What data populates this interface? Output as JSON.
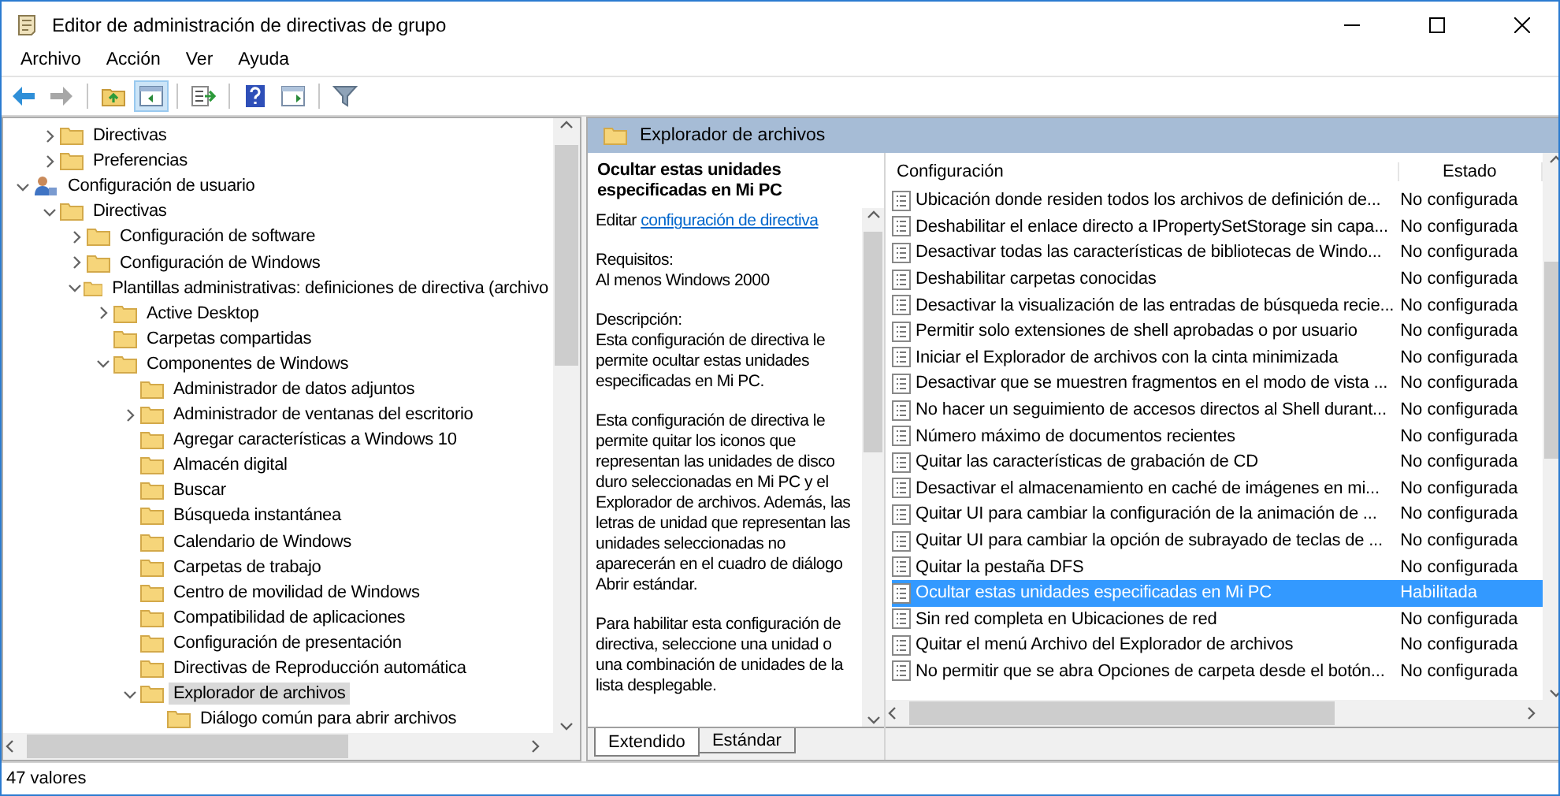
{
  "window": {
    "title": "Editor de administración de directivas de grupo"
  },
  "menu": [
    "Archivo",
    "Acción",
    "Ver",
    "Ayuda"
  ],
  "toolbar": [
    {
      "kind": "back",
      "disabled": false,
      "pressed": false
    },
    {
      "kind": "forward",
      "disabled": true,
      "pressed": false
    },
    {
      "kind": "up",
      "disabled": false,
      "pressed": false
    },
    {
      "kind": "tree",
      "disabled": false,
      "pressed": true
    },
    {
      "kind": "export",
      "disabled": false,
      "pressed": false
    },
    {
      "kind": "help",
      "disabled": false,
      "pressed": false
    },
    {
      "kind": "properties",
      "disabled": false,
      "pressed": false
    },
    {
      "kind": "filter",
      "disabled": false,
      "pressed": false
    }
  ],
  "tree": {
    "partial_branch": [
      {
        "label": "Directivas",
        "kind": "folder",
        "expanded": false,
        "selected": false
      },
      {
        "label": "Preferencias",
        "kind": "folder",
        "expanded": false,
        "selected": false
      }
    ],
    "items": [
      {
        "label": "Configuración de usuario",
        "kind": "user",
        "expanded": true,
        "selected": false,
        "children": [
          {
            "label": "Directivas",
            "kind": "folder",
            "expanded": true,
            "selected": false,
            "children": [
              {
                "label": "Configuración de software",
                "kind": "folder",
                "expanded": false,
                "selected": false
              },
              {
                "label": "Configuración de Windows",
                "kind": "folder",
                "expanded": false,
                "selected": false
              },
              {
                "label": "Plantillas administrativas: definiciones de directiva (archivo",
                "kind": "folder",
                "expanded": true,
                "selected": false,
                "children": [
                  {
                    "label": "Active Desktop",
                    "kind": "folder",
                    "expanded": false,
                    "selected": false
                  },
                  {
                    "label": "Carpetas compartidas",
                    "kind": "folder",
                    "selected": false
                  },
                  {
                    "label": "Componentes de Windows",
                    "kind": "folder",
                    "expanded": true,
                    "selected": false,
                    "children": [
                      {
                        "label": "Administrador de datos adjuntos",
                        "kind": "folder",
                        "selected": false
                      },
                      {
                        "label": "Administrador de ventanas del escritorio",
                        "kind": "folder",
                        "expanded": false,
                        "selected": false
                      },
                      {
                        "label": "Agregar características a Windows 10",
                        "kind": "folder",
                        "selected": false
                      },
                      {
                        "label": "Almacén digital",
                        "kind": "folder",
                        "selected": false
                      },
                      {
                        "label": "Buscar",
                        "kind": "folder",
                        "selected": false
                      },
                      {
                        "label": "Búsqueda instantánea",
                        "kind": "folder",
                        "selected": false
                      },
                      {
                        "label": "Calendario de Windows",
                        "kind": "folder",
                        "selected": false
                      },
                      {
                        "label": "Carpetas de trabajo",
                        "kind": "folder",
                        "selected": false
                      },
                      {
                        "label": "Centro de movilidad de Windows",
                        "kind": "folder",
                        "selected": false
                      },
                      {
                        "label": "Compatibilidad de aplicaciones",
                        "kind": "folder",
                        "selected": false
                      },
                      {
                        "label": "Configuración de presentación",
                        "kind": "folder",
                        "selected": false
                      },
                      {
                        "label": "Directivas de Reproducción automática",
                        "kind": "folder",
                        "selected": false
                      },
                      {
                        "label": "Explorador de archivos",
                        "kind": "folder",
                        "expanded": true,
                        "selected": true,
                        "children": [
                          {
                            "label": "Diálogo común para abrir archivos",
                            "kind": "folder",
                            "selected": false
                          }
                        ]
                      }
                    ]
                  }
                ]
              }
            ]
          }
        ]
      }
    ]
  },
  "pane_header": {
    "title": "Explorador de archivos"
  },
  "description": {
    "title": "Ocultar estas unidades especificadas en Mi PC",
    "edit_prefix": "Editar",
    "edit_link": "configuración de directiva",
    "paragraphs": [
      "Requisitos:\nAl menos Windows 2000",
      "Descripción:\nEsta configuración de directiva le permite ocultar estas unidades especificadas en Mi PC.",
      "Esta configuración de directiva le permite quitar los iconos que representan las unidades de disco duro seleccionadas en Mi PC y el Explorador de archivos. Además, las letras de unidad que representan las unidades seleccionadas no aparecerán en el cuadro de diálogo Abrir estándar.",
      "Para habilitar esta configuración de directiva, seleccione una unidad o una combinación de unidades de la lista desplegable."
    ]
  },
  "view_tabs": [
    {
      "label": "Extendido",
      "selected": true
    },
    {
      "label": "Estándar",
      "selected": false
    }
  ],
  "table": {
    "columns": [
      "Configuración",
      "Estado"
    ],
    "rows": [
      {
        "name": "Ubicación donde residen todos los archivos de definición de...",
        "state": "No configurada",
        "selected": false
      },
      {
        "name": "Deshabilitar el enlace directo a IPropertySetStorage sin capa...",
        "state": "No configurada",
        "selected": false
      },
      {
        "name": "Desactivar todas las características de bibliotecas de Windo...",
        "state": "No configurada",
        "selected": false
      },
      {
        "name": "Deshabilitar carpetas conocidas",
        "state": "No configurada",
        "selected": false
      },
      {
        "name": "Desactivar la visualización de las entradas de búsqueda recie...",
        "state": "No configurada",
        "selected": false
      },
      {
        "name": "Permitir solo extensiones de shell aprobadas o por usuario",
        "state": "No configurada",
        "selected": false
      },
      {
        "name": "Iniciar el Explorador de archivos con la cinta minimizada",
        "state": "No configurada",
        "selected": false
      },
      {
        "name": "Desactivar que se muestren fragmentos en el modo de vista ...",
        "state": "No configurada",
        "selected": false
      },
      {
        "name": "No hacer un seguimiento de accesos directos al Shell durant...",
        "state": "No configurada",
        "selected": false
      },
      {
        "name": "Número máximo de documentos recientes",
        "state": "No configurada",
        "selected": false
      },
      {
        "name": "Quitar las características de grabación de CD",
        "state": "No configurada",
        "selected": false
      },
      {
        "name": "Desactivar el almacenamiento en caché de imágenes en mi...",
        "state": "No configurada",
        "selected": false
      },
      {
        "name": "Quitar UI para cambiar la configuración de la animación de ...",
        "state": "No configurada",
        "selected": false
      },
      {
        "name": "Quitar UI para cambiar la opción de subrayado de teclas de ...",
        "state": "No configurada",
        "selected": false
      },
      {
        "name": "Quitar la pestaña DFS",
        "state": "No configurada",
        "selected": false
      },
      {
        "name": "Ocultar estas unidades especificadas en Mi PC",
        "state": "Habilitada",
        "selected": true
      },
      {
        "name": "Sin red completa en Ubicaciones de red",
        "state": "No configurada",
        "selected": false
      },
      {
        "name": "Quitar el menú Archivo del Explorador de archivos",
        "state": "No configurada",
        "selected": false
      },
      {
        "name": "No permitir que se abra Opciones de carpeta desde el botón...",
        "state": "No configurada",
        "selected": false
      }
    ]
  },
  "status_bar": "47 valores"
}
